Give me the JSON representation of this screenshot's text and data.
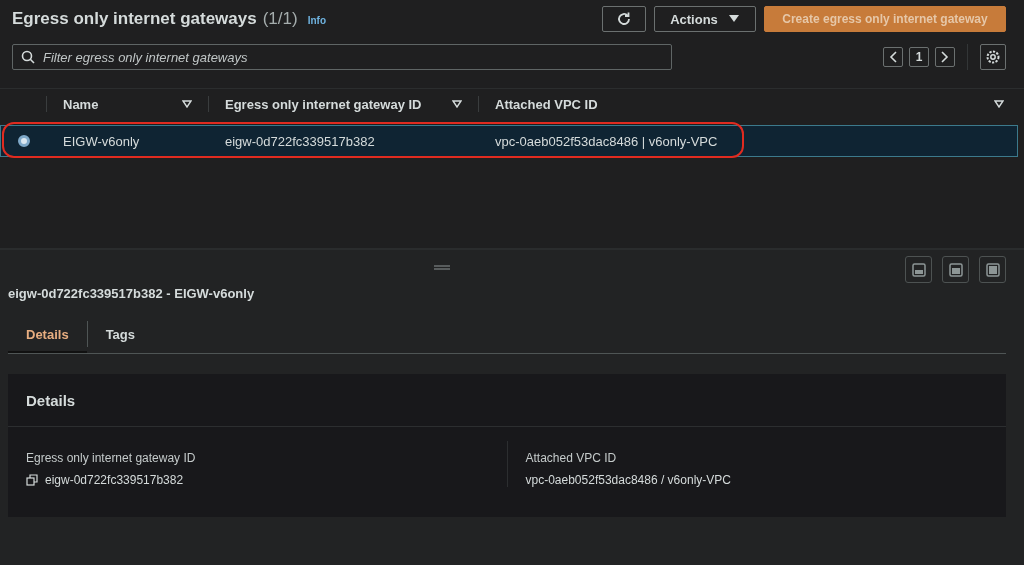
{
  "header": {
    "title": "Egress only internet gateways",
    "count": "(1/1)",
    "info": "Info",
    "actions": "Actions",
    "create": "Create egress only internet gateway"
  },
  "filter": {
    "placeholder": "Filter egress only internet gateways"
  },
  "pagination": {
    "page": "1"
  },
  "table": {
    "columns": [
      "Name",
      "Egress only internet gateway ID",
      "Attached VPC ID"
    ],
    "rows": [
      {
        "selected": true,
        "highlighted": true,
        "cells": [
          "EIGW-v6only",
          "eigw-0d722fc339517b382",
          "vpc-0aeb052f53dac8486 | v6only-VPC"
        ]
      }
    ]
  },
  "detail": {
    "title": "eigw-0d722fc339517b382 - EIGW-v6only",
    "tabs": [
      {
        "label": "Details",
        "selected": true
      },
      {
        "label": "Tags",
        "selected": false
      }
    ],
    "card_title": "Details",
    "fields": [
      {
        "label": "Egress only internet gateway ID",
        "value": "eigw-0d722fc339517b382",
        "copyable": true
      },
      {
        "label": "Attached VPC ID",
        "value": "vpc-0aeb052f53dac8486 / v6only-VPC",
        "copyable": false
      }
    ]
  }
}
